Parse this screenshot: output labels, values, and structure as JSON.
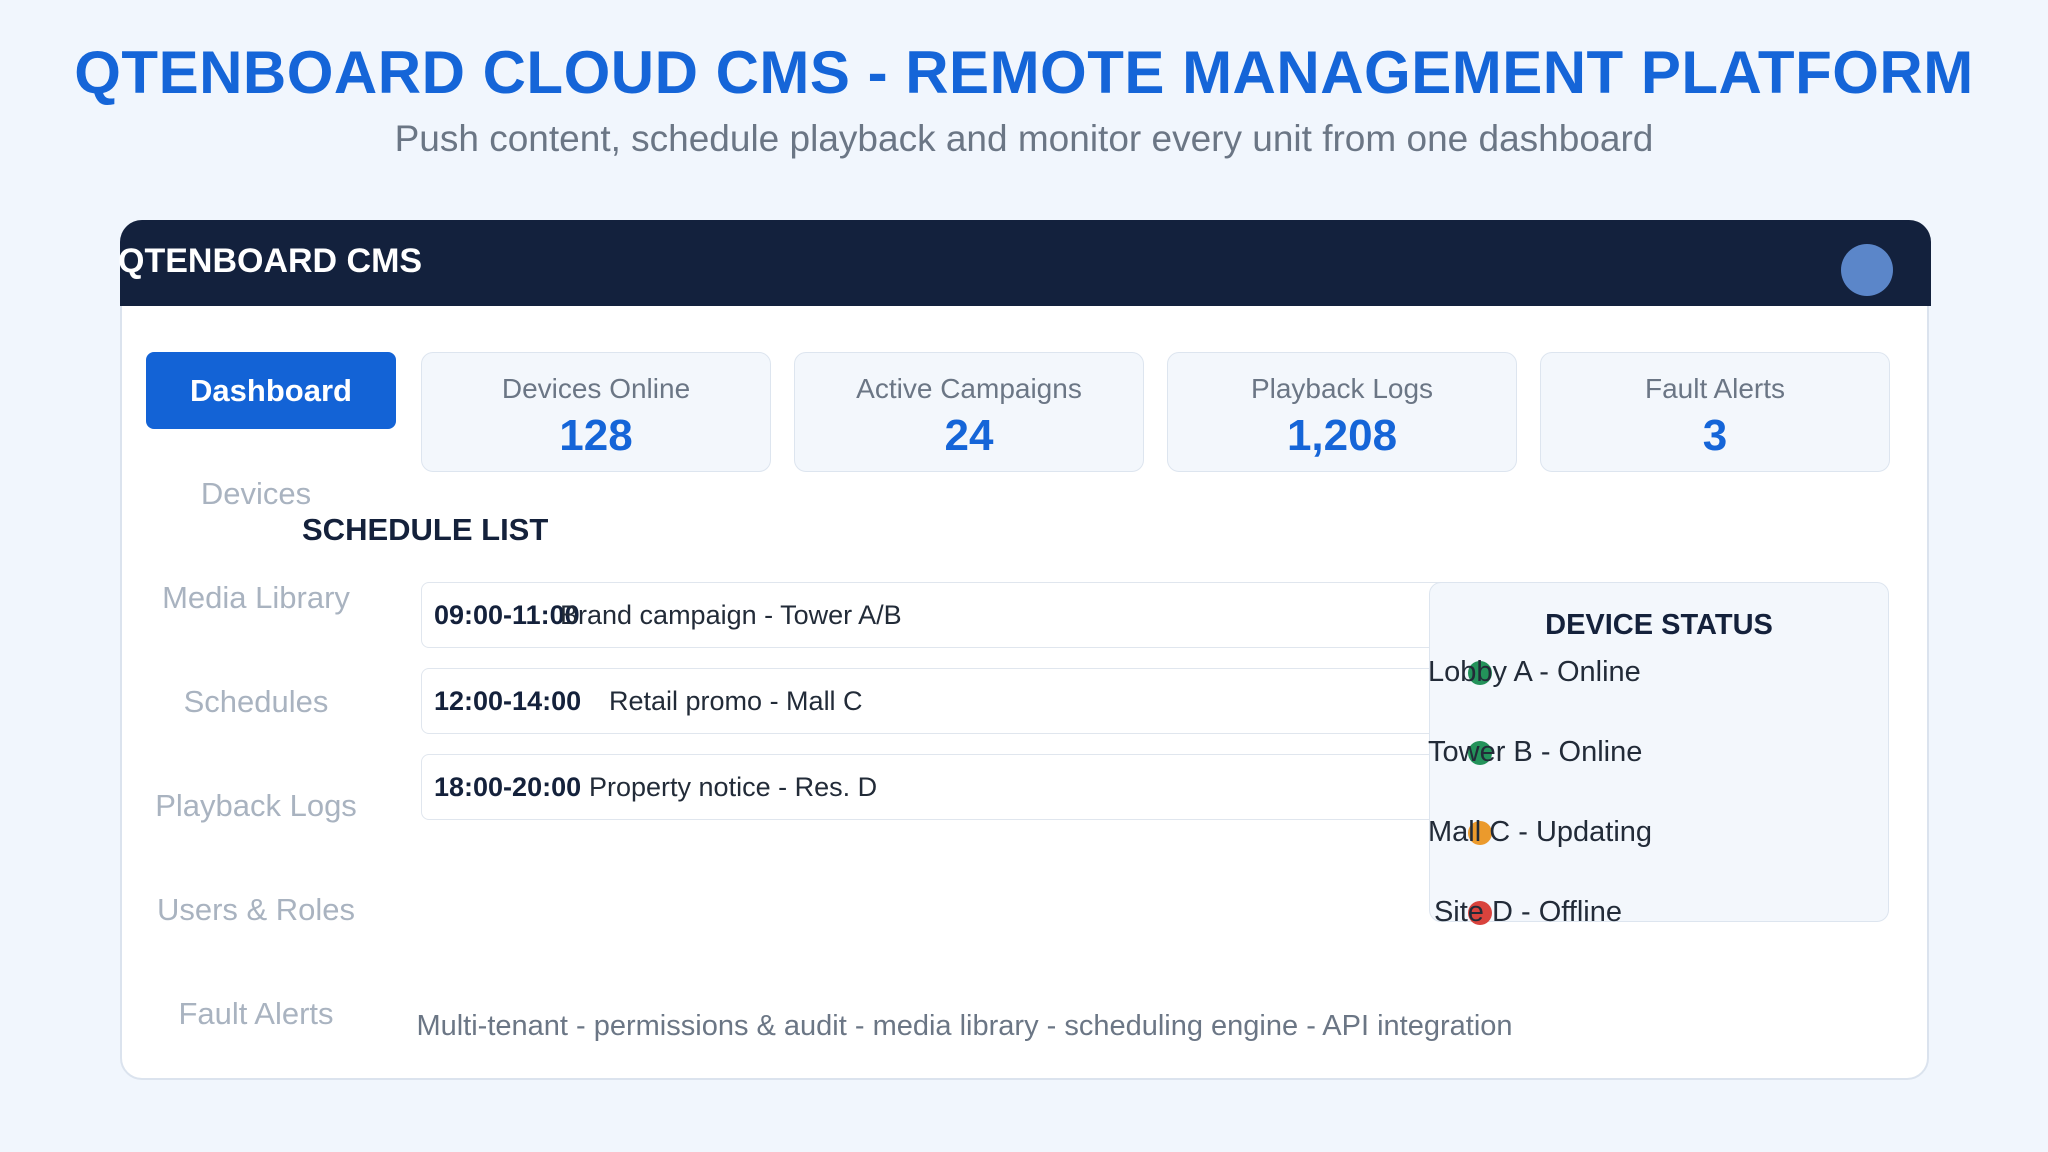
{
  "page": {
    "title": "QTENBOARD CLOUD CMS - REMOTE MANAGEMENT PLATFORM",
    "subtitle": "Push content, schedule playback and monitor every unit from one dashboard"
  },
  "app": {
    "brand": "QTENBOARD CMS",
    "accent_color": "#1565d8",
    "topbar_color": "#13213d"
  },
  "sidebar": {
    "active": "Dashboard",
    "items": [
      {
        "label": "Devices"
      },
      {
        "label": "Media Library"
      },
      {
        "label": "Schedules"
      },
      {
        "label": "Playback Logs"
      },
      {
        "label": "Users & Roles"
      },
      {
        "label": "Fault Alerts"
      }
    ]
  },
  "stats": [
    {
      "label": "Devices Online",
      "value": "128"
    },
    {
      "label": "Active Campaigns",
      "value": "24"
    },
    {
      "label": "Playback Logs",
      "value": "1,208"
    },
    {
      "label": "Fault Alerts",
      "value": "3"
    }
  ],
  "schedule": {
    "title": "SCHEDULE LIST",
    "rows": [
      {
        "time": "09:00-11:00",
        "title": "Brand campaign - Tower A/B"
      },
      {
        "time": "12:00-14:00",
        "title": "Retail promo - Mall C"
      },
      {
        "time": "18:00-20:00",
        "title": "Property notice - Res. D"
      }
    ]
  },
  "device_status": {
    "title": "DEVICE STATUS",
    "items": [
      {
        "label": "Lobby A - Online",
        "color": "#23925a"
      },
      {
        "label": "Tower B - Online",
        "color": "#23925a"
      },
      {
        "label": "Mall C - Updating",
        "color": "#eb9a2c"
      },
      {
        "label": "Site D - Offline",
        "color": "#d9433d"
      }
    ]
  },
  "footer": {
    "text": "Multi-tenant - permissions & audit - media library - scheduling engine - API integration"
  }
}
